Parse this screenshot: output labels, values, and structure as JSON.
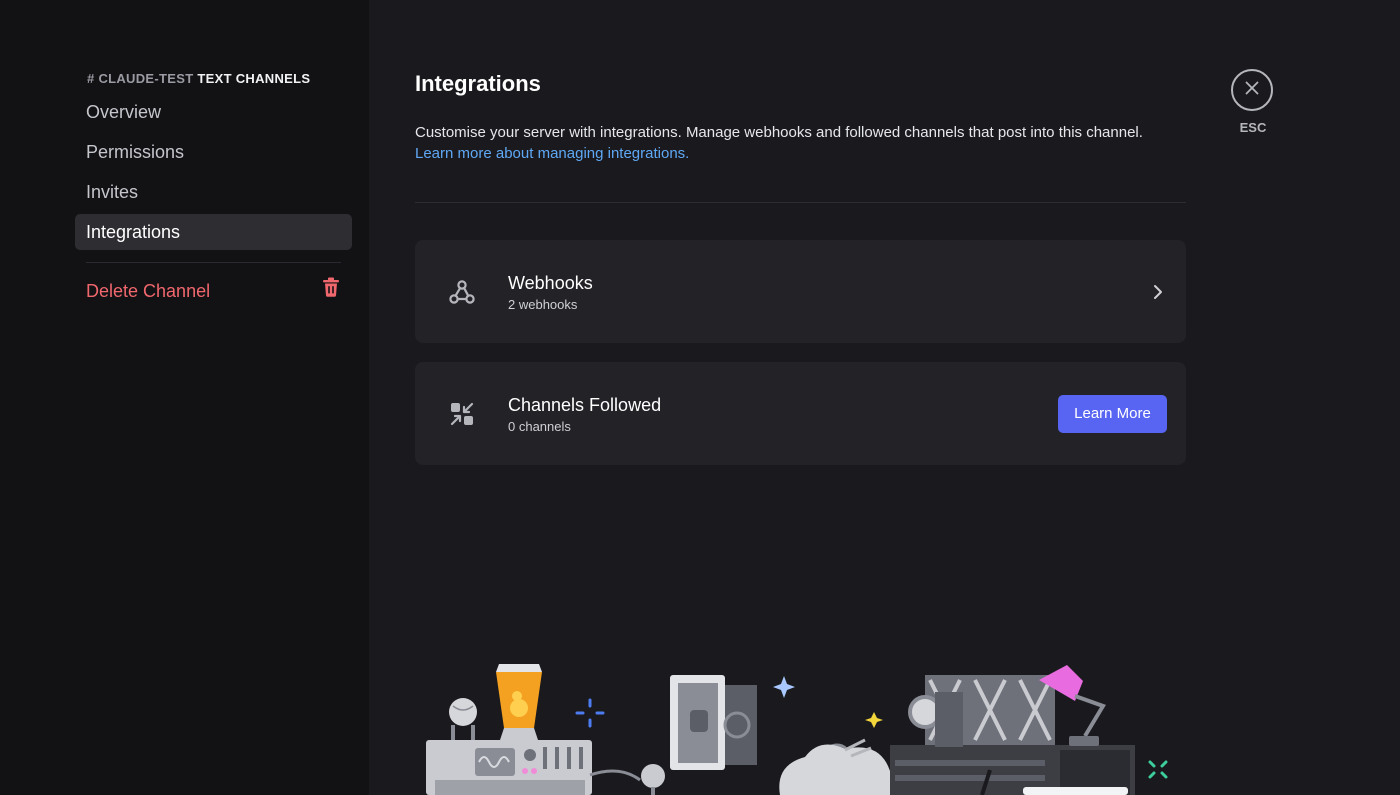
{
  "sidebar": {
    "header_channel": "# CLAUDE-TEST",
    "header_category": "TEXT CHANNELS",
    "items": [
      {
        "label": "Overview"
      },
      {
        "label": "Permissions"
      },
      {
        "label": "Invites"
      },
      {
        "label": "Integrations",
        "active": true
      }
    ],
    "delete_label": "Delete Channel",
    "delete_icon": "trash-icon"
  },
  "main": {
    "title": "Integrations",
    "description": "Customise your server with integrations. Manage webhooks and followed channels that post into this channel.",
    "learn_link": "Learn more about managing integrations.",
    "cards": [
      {
        "icon": "webhook-icon",
        "title": "Webhooks",
        "subtitle": "2 webhooks",
        "action": "chevron-right-icon"
      },
      {
        "icon": "channels-followed-icon",
        "title": "Channels Followed",
        "subtitle": "0 channels",
        "button": "Learn More"
      }
    ]
  },
  "close": {
    "label": "ESC",
    "icon": "close-icon"
  },
  "colors": {
    "accent": "#5865f2",
    "danger": "#f0676d",
    "link": "#5fa8f5",
    "sidebar_bg": "#121214",
    "main_bg": "#1a1a1e",
    "card_bg": "#222227"
  }
}
